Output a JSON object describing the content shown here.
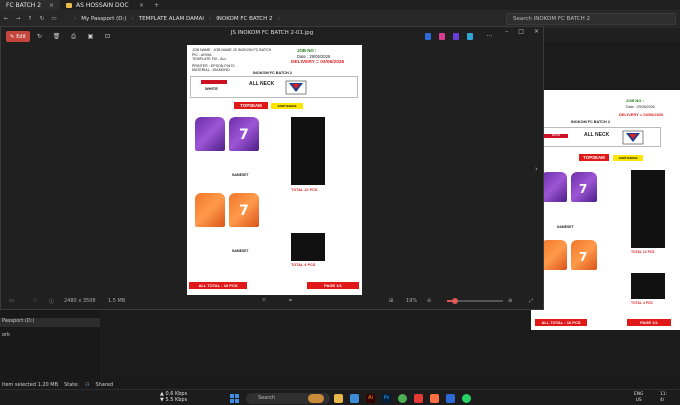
{
  "explorer": {
    "tabs": [
      {
        "label": "FC BATCH 2"
      },
      {
        "label": "AS HOSSAIN DOC"
      }
    ],
    "breadcrumb": [
      "My Passport (D:)",
      "TEMPLATE ALAM DAMAI",
      "INOKOM FC BATCH 2"
    ],
    "search_placeholder": "Search INOKOM FC BATCH 2",
    "nav_items": [
      {
        "label": "Passport (D:)"
      },
      {
        "label": "ork"
      }
    ],
    "status": {
      "selection": "item selected  1.20 MB",
      "state": "State:",
      "shared": "Shared"
    }
  },
  "viewer": {
    "title": "JS INOKOM FC BATCH 2-01.jpg",
    "edit_label": "Edit",
    "footer": {
      "dimensions": "2480 x 3508",
      "filesize": "1.5 MB",
      "zoom": "19%"
    }
  },
  "document": {
    "header_left": [
      "JOB NAME",
      "PIC",
      "TEMPLATE FIX",
      "PRINTER",
      "MATERIAL"
    ],
    "header_left_values": [
      ": JOB NAME  JS INOKOM FC BATCH",
      ": AISHA",
      ": ALL",
      ": EPSON F9470",
      ": DIAMOND"
    ],
    "job_no": "JOB NO :",
    "date": "Date : 29/05/2026",
    "delivery": "DELIVERY = 03/06/2026",
    "batch_title": "INOKOM FC BATCH 2",
    "collar_label": "WHITE",
    "neck_label": "ALL NECK",
    "topseam": "TOPSEAM",
    "stitching_label": "JAHIT BADGE",
    "jersey_number": "7",
    "nameset": "NAMESET",
    "group1_total": "TOTAL  12 PCS",
    "group2_total": "TOTAL  4 PCS",
    "footer_all_total": "ALL TOTAL : 16 PCS",
    "footer_page": "PAGE  1/1"
  },
  "preview": {
    "job_no": "JOB NO :",
    "date": "Date : 29/05/2026",
    "delivery": "DELIVERY = 03/06/2026",
    "batch_title": "INOKOM FC BATCH 2",
    "collar_label": "WHITE",
    "neck_label": "ALL NECK",
    "topseam": "TOPSEAM",
    "nameset": "NAMESET",
    "group1_total": "TOTAL  12 PCS",
    "group2_total": "TOTAL  4 PCS",
    "footer_all_total": "ALL TOTAL : 16 PCS",
    "footer_page": "PAGE  1/1"
  },
  "taskbar": {
    "net_up": "0.6 Kbps",
    "net_down": "5.5 Kbps",
    "search": "Search",
    "tray_lang": "ENG",
    "tray_region": "US",
    "clock_time": "11:",
    "clock_date": "4/"
  },
  "colors": {
    "edit_accent": "#c3453e",
    "doc_red": "#e01818",
    "jersey_purple": "#6b2fa8",
    "jersey_orange": "#f0772a"
  }
}
